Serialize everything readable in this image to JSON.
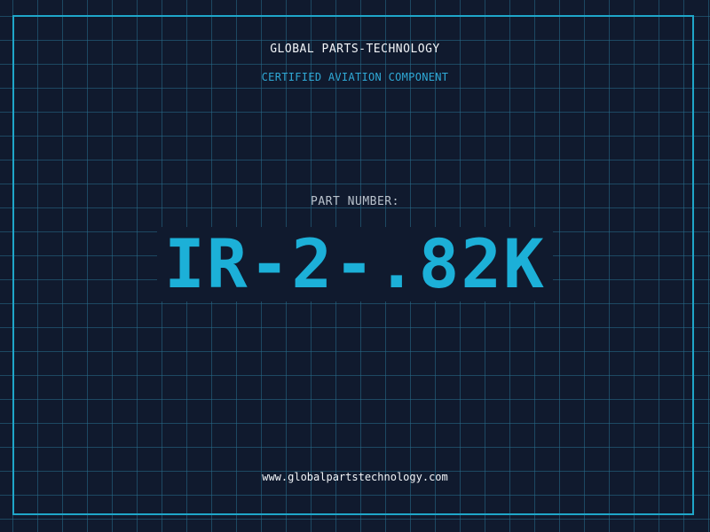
{
  "header": {
    "company": "GLOBAL PARTS-TECHNOLOGY",
    "certification": "CERTIFIED AVIATION COMPONENT"
  },
  "part": {
    "label": "PART NUMBER:",
    "number": "IR-2-.82K"
  },
  "footer": {
    "url": "www.globalpartstechnology.com"
  },
  "colors": {
    "background": "#101a2e",
    "grid": "#286e8c",
    "accent": "#1cb0d8",
    "text": "#f2f5f8"
  }
}
